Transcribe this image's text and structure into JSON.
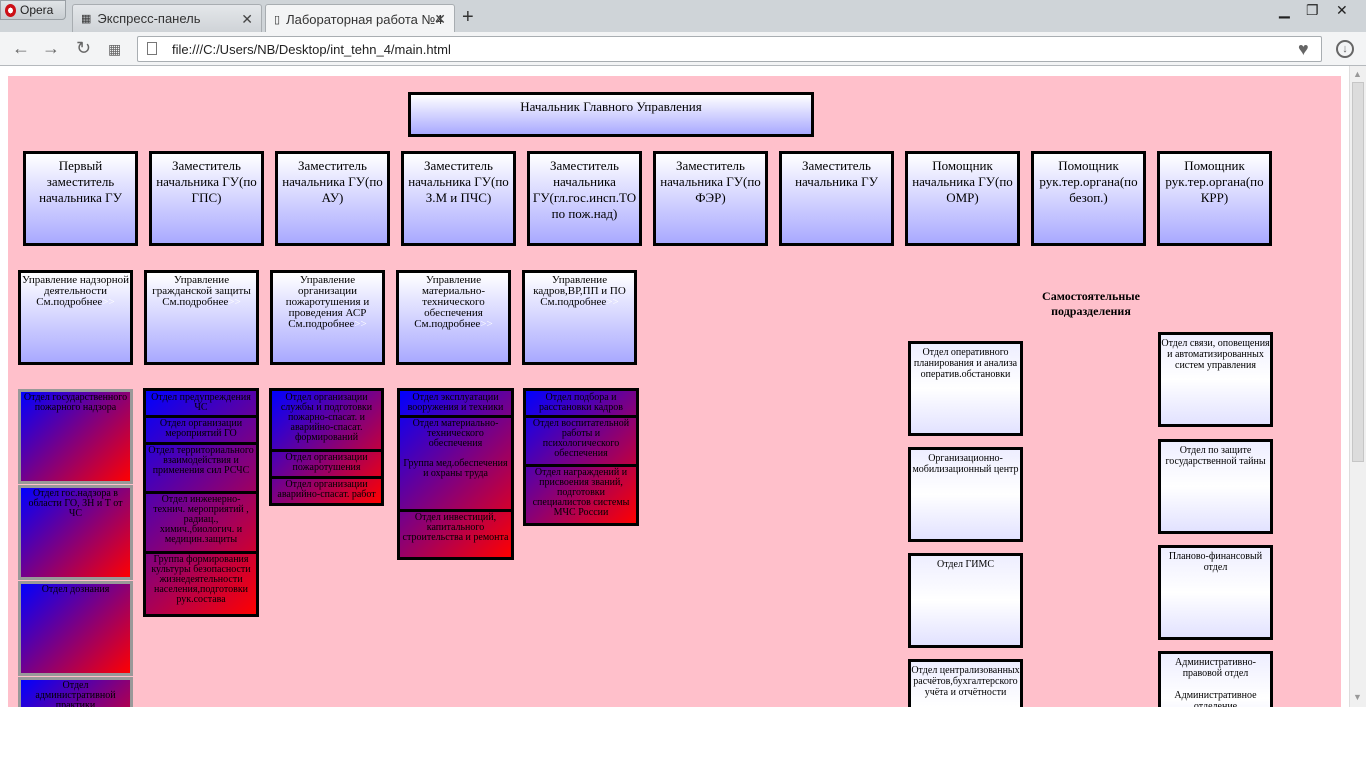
{
  "browser": {
    "menu_label": "Opera",
    "tabs": [
      {
        "label": "Экспресс-панель"
      },
      {
        "label": "Лабораторная работа №4"
      }
    ],
    "address": "file:///C:/Users/NB/Desktop/int_tehn_4/main.html"
  },
  "chart": {
    "head": "Начальник Главного Управления",
    "deputies": [
      "Первый заместитель начальника ГУ",
      "Заместитель начальника ГУ(по ГПС)",
      "Заместитель начальника ГУ(по АУ)",
      "Заместитель начальника ГУ(по З.М и ПЧС)",
      "Заместитель начальника ГУ(гл.гос.инсп.ТО по пож.над)",
      "Заместитель начальника ГУ(по ФЭР)",
      "Заместитель начальника ГУ",
      "Помощник начальника ГУ(по ОМР)",
      "Помощник рук.тер.органа(по безоп.)",
      "Помощник рук.тер.органа(по КРР)"
    ],
    "more_label": "См.подробнее",
    "more_arrow": ">>",
    "departments": [
      {
        "title": "Управление надзорной деятельности"
      },
      {
        "title": "Управление гражданской защиты"
      },
      {
        "title": "Управление организации пожаротушения и проведения АСР"
      },
      {
        "title": "Управление материально-технического обеспечения"
      },
      {
        "title": "Управление кадров,ВР,ПП и ПО"
      }
    ],
    "col1": [
      "Отдел государственного пожарного надзора",
      "Отдел гос.надзора в области ГО, ЗН и Т от ЧС",
      "Отдел дознания",
      "Отдел административной практики"
    ],
    "col2": [
      "Отдел предупреждения ЧС",
      "Отдел организации мероприятий ГО",
      "Отдел территориального взаимодействия и применения сил РСЧС",
      "Отдел инженерно-технич. мероприятий , радиац., химич.,биологич. и медицин.защиты",
      "Группа формирования культуры безопасности жизнедеятельности населения,подготовки рук.состава"
    ],
    "col3": [
      "Отдел организации службы и подготовки пожарно-спасат. и аварийно-спасат. формирований",
      "Отдел организации пожаротушения",
      "Отдел организации аварийно-спасат. работ"
    ],
    "col4": [
      "Отдел эксплуатации вооружения и техники",
      "Отдел материально-технического обеспечения",
      "Группа мед.обеспечения и охраны труда",
      "Отдел инвестиций, капитального строительства и ремонта"
    ],
    "col5": [
      "Отдел подбора и расстановки кадров",
      "Отдел воспитательной работы и психологического обеспечения",
      "Отдел награждений и присвоения званий, подготовки специалистов системы МЧС России"
    ],
    "independent_heading": "Самостоятельные подразделения",
    "independent_left": [
      "Отдел оперативного планирования и анализа оператив.обстановки",
      "Организационно-мобилизационный центр",
      "Отдел ГИМС",
      "Отдел централизованных расчётов,бухгалтерского учёта и отчётности"
    ],
    "independent_right": [
      "Отдел связи, оповещения и автоматизированных систем управления",
      "Отдел по защите государственной тайны",
      "Планово-финансовый отдел",
      "Административно-правовой отдел",
      "Административное отделение"
    ]
  }
}
